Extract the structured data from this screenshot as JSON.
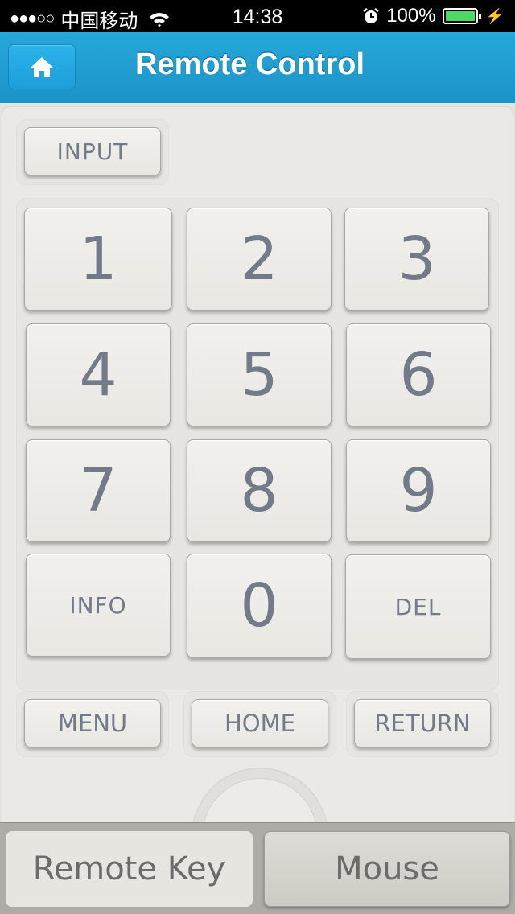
{
  "status_bar": {
    "signal": "●●●○○",
    "carrier": "中国移动",
    "wifi_icon": "wifi-icon",
    "time": "14:38",
    "alarm_icon": "alarm-icon",
    "battery_percent": "100%",
    "battery_level": 1.0,
    "battery_color": "#4cd964",
    "charging_icon": "bolt-icon"
  },
  "nav": {
    "title": "Remote Control",
    "home_icon": "home-icon",
    "accent": "#1e9ed8"
  },
  "remote": {
    "input_label": "INPUT",
    "keypad": [
      "1",
      "2",
      "3",
      "4",
      "5",
      "6",
      "7",
      "8",
      "9",
      "INFO",
      "0",
      "DEL"
    ],
    "function_keys": [
      "MENU",
      "HOME",
      "RETURN"
    ],
    "dpad_icon": "dpad-icon"
  },
  "tabs": [
    {
      "label": "Remote Key",
      "selected": true
    },
    {
      "label": "Mouse",
      "selected": false
    }
  ]
}
